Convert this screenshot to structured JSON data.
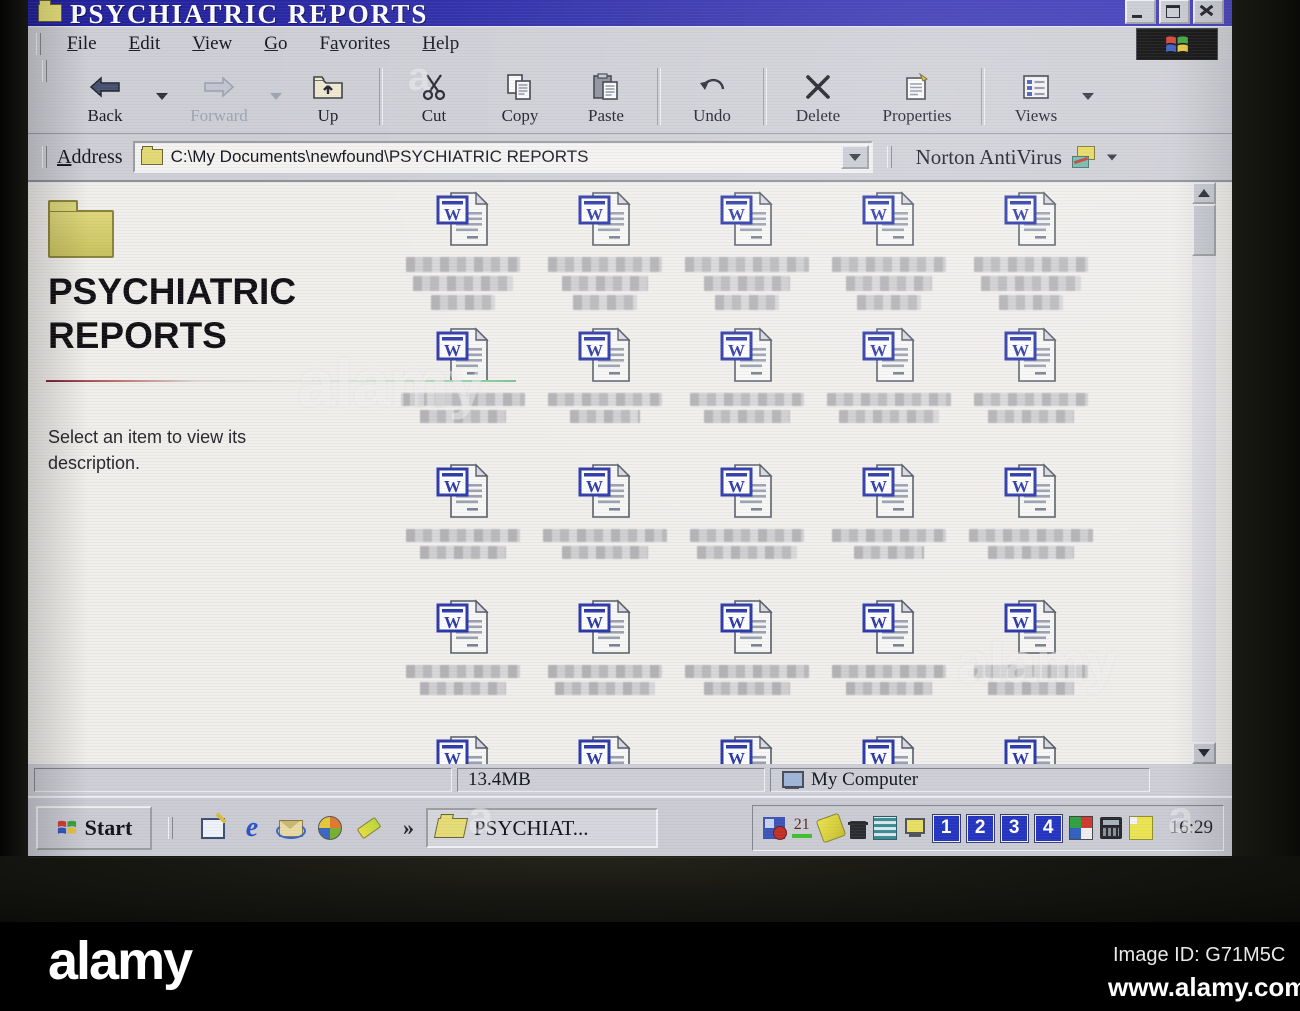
{
  "photo": {
    "brand": "alamy",
    "brand_short": "a",
    "image_id": "Image ID: G71M5C",
    "url": "www.alamy.com"
  },
  "window": {
    "title": "PSYCHIATRIC REPORTS"
  },
  "menu": {
    "items": [
      {
        "pre": "",
        "u": "F",
        "post": "ile"
      },
      {
        "pre": "",
        "u": "E",
        "post": "dit"
      },
      {
        "pre": "",
        "u": "V",
        "post": "iew"
      },
      {
        "pre": "",
        "u": "G",
        "post": "o"
      },
      {
        "pre": "F",
        "u": "a",
        "post": "vorites"
      },
      {
        "pre": "",
        "u": "H",
        "post": "elp"
      }
    ]
  },
  "toolbar": {
    "buttons": [
      {
        "label": "Back"
      },
      {
        "label": "Forward"
      },
      {
        "label": "Up"
      },
      {
        "label": "Cut"
      },
      {
        "label": "Copy"
      },
      {
        "label": "Paste"
      },
      {
        "label": "Undo"
      },
      {
        "label": "Delete"
      },
      {
        "label": "Properties"
      },
      {
        "label": "Views"
      }
    ]
  },
  "address": {
    "label_u": "A",
    "label_rest": "ddress",
    "path": "C:\\My Documents\\newfound\\PSYCHIATRIC REPORTS",
    "norton_label": "Norton AntiVirus"
  },
  "sidebar": {
    "title_line1": "PSYCHIATRIC",
    "title_line2": "REPORTS",
    "description": "Select an item to view its description."
  },
  "files": {
    "count": 25,
    "icon": "word-document",
    "labels_redacted": true
  },
  "statusbar": {
    "panel1": "",
    "size": "13.4MB",
    "location": "My Computer"
  },
  "taskbar": {
    "start_label": "Start",
    "overflow_chevron": "»",
    "task_label": "PSYCHIAT...",
    "tray_badge": "21",
    "desktop_buttons": [
      "1",
      "2",
      "3",
      "4"
    ],
    "clock": "16:29"
  }
}
